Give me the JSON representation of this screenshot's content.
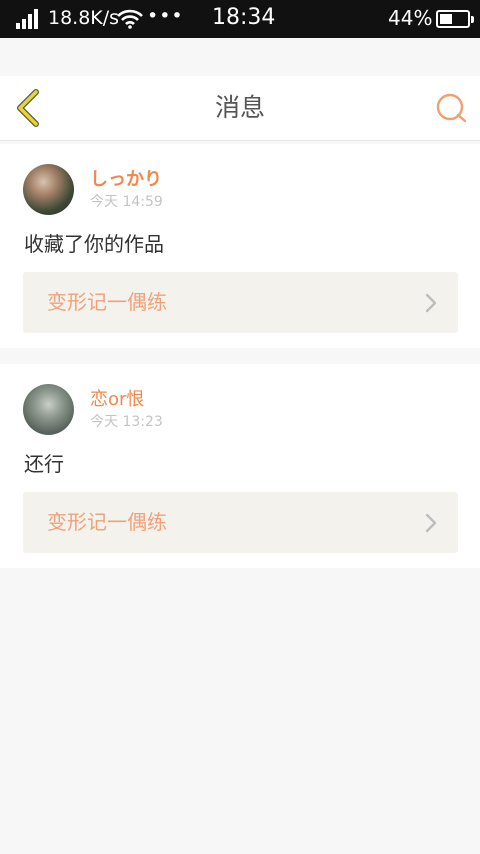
{
  "status_bar": {
    "network_speed": "18.8K/s",
    "dots": "•••",
    "time": "18:34",
    "battery": "44%"
  },
  "header": {
    "title": "消息"
  },
  "messages": [
    {
      "username": "しっかり",
      "timestamp": "今天 14:59",
      "text": "收藏了你的作品",
      "work_title": "变形记一偶练"
    },
    {
      "username": "恋or恨",
      "timestamp": "今天 13:23",
      "text": "还行",
      "work_title": "变形记一偶练"
    }
  ],
  "colors": {
    "accent": "#f0884d",
    "back_arrow": "#e8d53a",
    "link_bg": "#f3f2ec"
  }
}
